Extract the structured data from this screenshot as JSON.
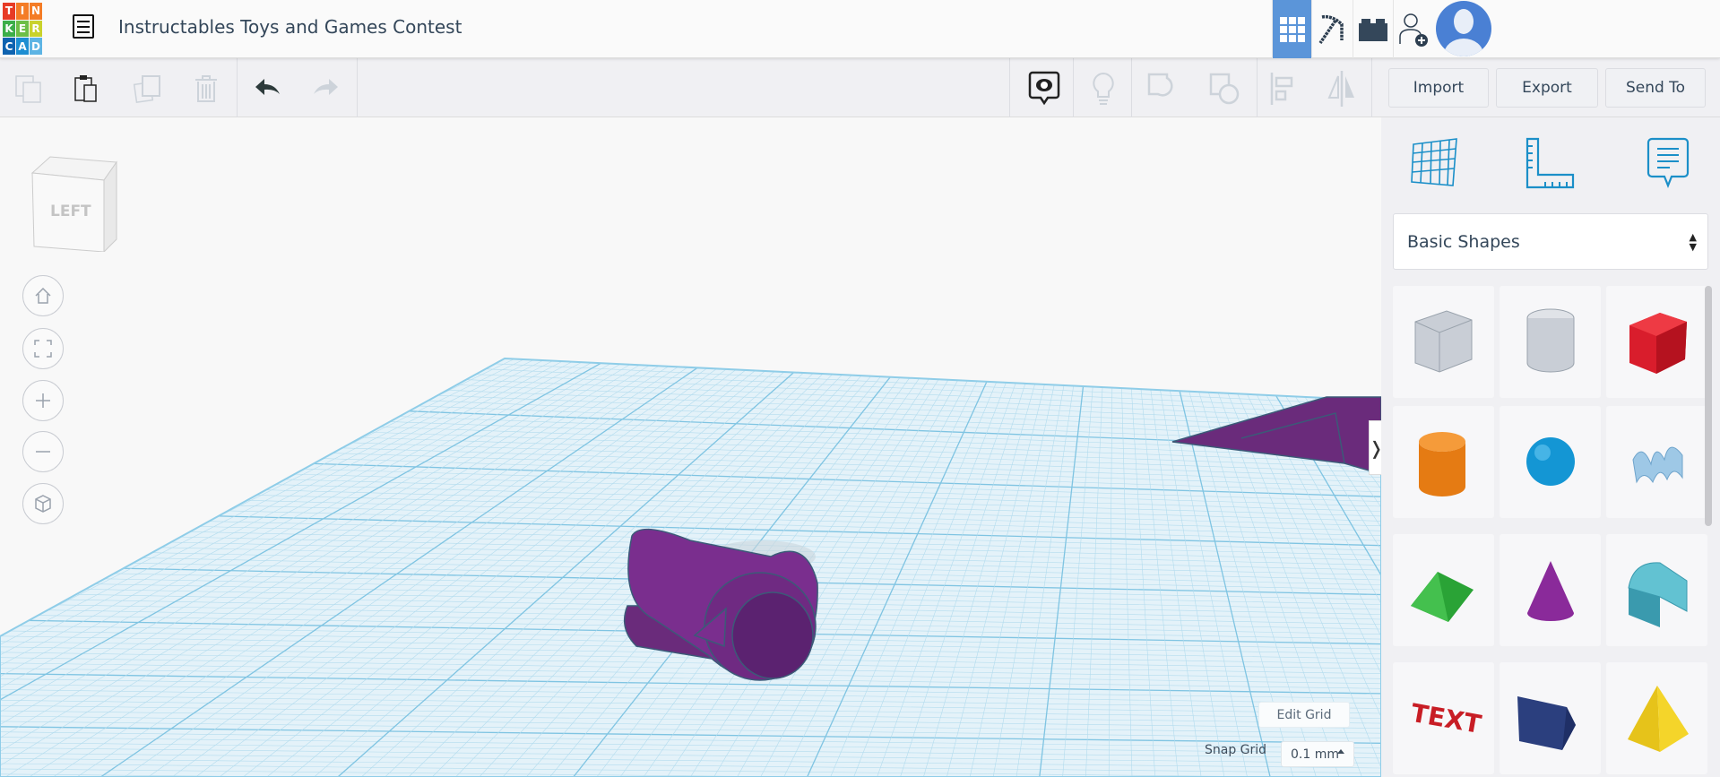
{
  "header": {
    "logo_letters": [
      "T",
      "I",
      "N",
      "K",
      "E",
      "R",
      "C",
      "A",
      "D"
    ],
    "logo_colors": [
      "#e73b26",
      "#f47c26",
      "#f47c26",
      "#3cae49",
      "#6dbe46",
      "#c9d22b",
      "#0e63b0",
      "#1d8ed2",
      "#5db4e4"
    ],
    "title": "Instructables Toys and Games Contest",
    "buttons": [
      "3d-design-icon",
      "codeblocks-pickaxe-icon",
      "lego-brick-icon",
      "invite-user-icon",
      "avatar"
    ],
    "accent": "#5b95d9"
  },
  "toolbar": {
    "left_tools": [
      "copy-icon",
      "paste-icon",
      "duplicate-icon",
      "delete-icon",
      "undo-icon",
      "redo-icon"
    ],
    "right_tools": [
      "notes-eye-icon",
      "light-bulb-icon",
      "group-icon",
      "ungroup-icon",
      "align-icon",
      "mirror-icon"
    ],
    "import_label": "Import",
    "export_label": "Export",
    "send_label": "Send To"
  },
  "viewcube": {
    "face_label": "LEFT"
  },
  "nav": [
    "home-icon",
    "fit-view-icon",
    "zoom-in-icon",
    "zoom-out-icon",
    "perspective-icon"
  ],
  "grid": {
    "edit_label": "Edit Grid",
    "snap_label": "Snap Grid",
    "snap_value": "0.1 mm"
  },
  "panel": {
    "tabs": [
      "workplane-icon",
      "ruler-icon",
      "notes-icon"
    ],
    "category": "Basic Shapes",
    "shapes": [
      "Box Hole",
      "Cylinder Hole",
      "Box",
      "Cylinder",
      "Sphere",
      "Scribble",
      "Roof",
      "Cone",
      "Round Roof",
      "Text",
      "Wedge",
      "Pyramid"
    ]
  }
}
